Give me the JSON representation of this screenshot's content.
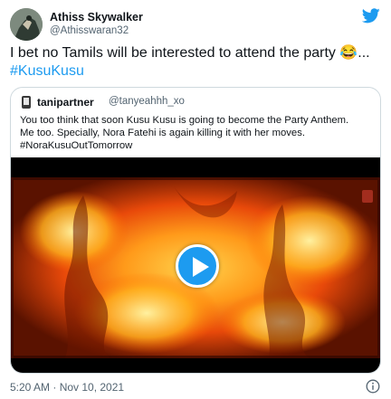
{
  "author": {
    "name": "Athiss Skywalker",
    "handle": "@Athisswaran32"
  },
  "tweet": {
    "text": "I bet no Tamils will be interested to attend the party 😂...",
    "hashtag": "#KusuKusu"
  },
  "quoted": {
    "name": "tanipartner",
    "handle": "@tanyeahhh_xo",
    "lines": [
      "You too think that soon Kusu Kusu is going to become the Party Anthem.",
      "Me too. Specially, Nora Fatehi is again killing it with her moves."
    ],
    "hashtag": "#NoraKusuOutTomorrow"
  },
  "footer": {
    "timestamp": "5:20 AM · Nov 10, 2021"
  },
  "colors": {
    "twitter_blue": "#1d9bf0",
    "text_primary": "#0f1419",
    "text_secondary": "#536471",
    "border": "#cfd9de"
  },
  "icons": {
    "brand": "twitter-bird-icon",
    "play": "play-icon",
    "info": "info-icon"
  }
}
